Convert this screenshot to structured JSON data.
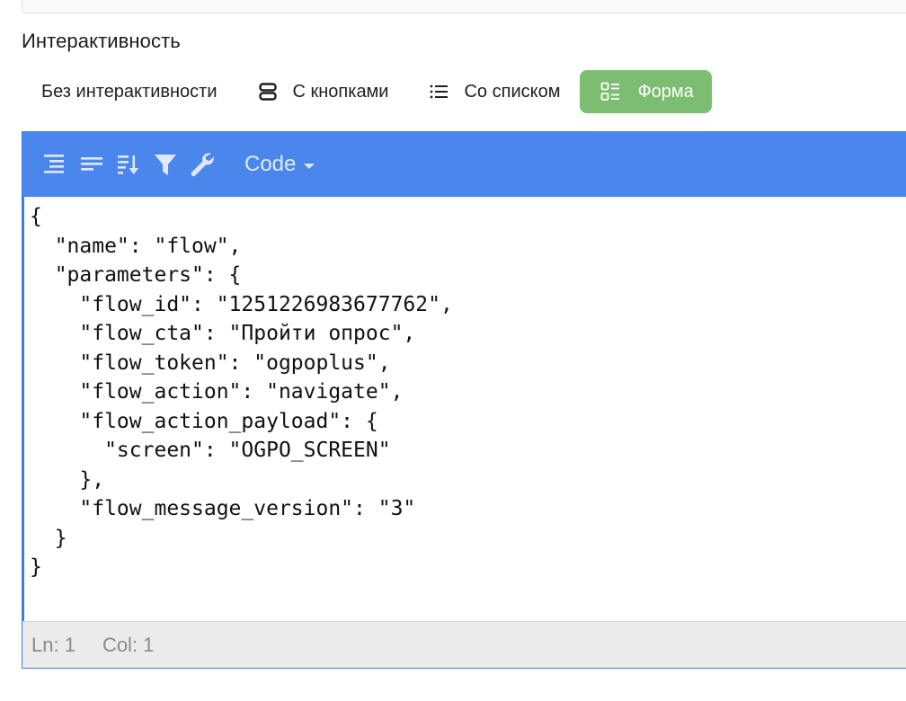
{
  "section": {
    "title": "Интерактивность"
  },
  "modes": [
    {
      "label": "Без интерактивности",
      "icon": "none",
      "active": false
    },
    {
      "label": "С кнопками",
      "icon": "buttons-icon",
      "active": false
    },
    {
      "label": "Со списком",
      "icon": "list-icon",
      "active": false
    },
    {
      "label": "Форма",
      "icon": "form-icon",
      "active": true
    }
  ],
  "editor": {
    "toolbar": {
      "icons": [
        "format-icon",
        "compact-icon",
        "sort-icon",
        "filter-icon",
        "repair-icon"
      ],
      "mode_label": "Code"
    },
    "code_lines": [
      "{",
      "  \"name\": \"flow\",",
      "  \"parameters\": {",
      "    \"flow_id\": \"1251226983677762\",",
      "    \"flow_cta\": \"Пройти опрос\",",
      "    \"flow_token\": \"ogpoplus\",",
      "    \"flow_action\": \"navigate\",",
      "    \"flow_action_payload\": {",
      "      \"screen\": \"OGPO_SCREEN\"",
      "    },",
      "    \"flow_message_version\": \"3\"",
      "  }",
      "}"
    ],
    "status": {
      "line": "Ln: 1",
      "col": "Col: 1"
    }
  },
  "colors": {
    "accent_green": "#7dbd72",
    "toolbar_blue": "#4a86ec",
    "border_blue": "#3c80e6"
  }
}
